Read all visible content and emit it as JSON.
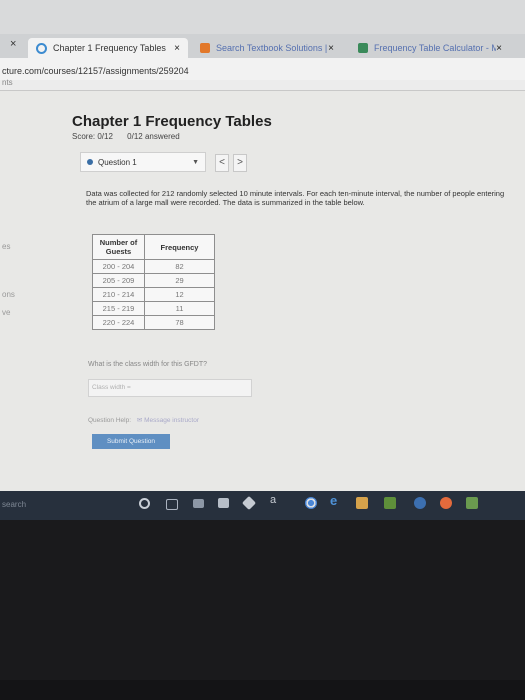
{
  "browser": {
    "tabs": [
      {
        "title": "Chapter 1 Frequency Tables",
        "close": "×"
      },
      {
        "title": "Search Textbook Solutions | Che",
        "close": "×"
      },
      {
        "title": "Frequency Table Calculator - Ma",
        "close": "×"
      }
    ],
    "left_close": "×",
    "new_tab": "+",
    "url": "cture.com/courses/12157/assignments/259204",
    "subnav_text": "nts"
  },
  "rail": [
    "es",
    "ons",
    "ve"
  ],
  "assignment": {
    "title": "Chapter 1 Frequency Tables",
    "score_label": "Score: 0/12",
    "answered": "0/12 answered",
    "question_select": "Question 1",
    "prev": "<",
    "next": ">"
  },
  "question": {
    "description": "Data was collected for 212 randomly selected 10 minute intervals. For each ten-minute interval, the number of people entering the atrium of a large mall were recorded. The data is summarized in the table below.",
    "table": {
      "headers": [
        "Number of Guests",
        "Frequency"
      ],
      "rows": [
        [
          "200 - 204",
          "82"
        ],
        [
          "205 - 209",
          "29"
        ],
        [
          "210 - 214",
          "12"
        ],
        [
          "215 - 219",
          "11"
        ],
        [
          "220 - 224",
          "78"
        ]
      ]
    },
    "prompt": "What is the class width for this GFDT?",
    "answer_placeholder": "Class width =",
    "help_label": "Question Help:",
    "message_label": "Message instructor",
    "submit_label": "Submit Question"
  },
  "taskbar": {
    "search_text": "search",
    "icons": [
      "cortana-icon",
      "task-view-icon",
      "photos-icon",
      "store-icon",
      "dropbox-icon",
      "amazon-icon",
      "chrome-icon",
      "edge-icon",
      "app-icon",
      "app-icon-2",
      "app-icon-3",
      "app-icon-4"
    ]
  }
}
